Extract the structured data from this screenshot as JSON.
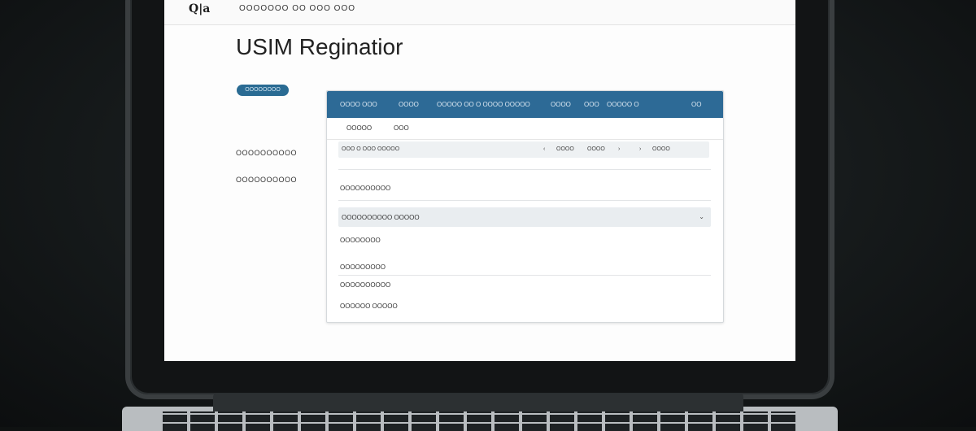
{
  "header": {
    "logo": "Q|a",
    "nav": "OOOOOOO OO OOO OOO"
  },
  "page": {
    "title": "USIM Reginatior",
    "pill_label": "OOOOOOOO"
  },
  "sidebar": {
    "items": [
      "OOOOOOOOOO",
      "OOOOOOOOOO"
    ]
  },
  "panel": {
    "header_items": [
      "OOOO OOO",
      "OOOO",
      "OOOOO OO O OOOO OOOOO",
      "OOOO",
      "OOO",
      "OOOOO O",
      "OO"
    ],
    "tabs": [
      "OOOOO",
      "OOO"
    ],
    "filter": {
      "left": "OOO O OOO OOOOO",
      "right_items": [
        "OOOO",
        "OOOO",
        "OOOO"
      ]
    },
    "rows": [
      "OOOOOOOOOO",
      "OOOOOOOOOO OOOOO",
      "OOOOOOOO",
      "OOOOOOOOO",
      "OOOOOOOOOO",
      "OOOOOO OOOOO"
    ],
    "highlight_arrow": "⌄"
  }
}
